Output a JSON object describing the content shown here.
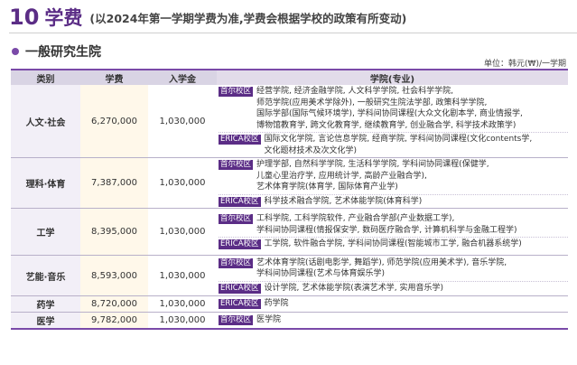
{
  "header": {
    "number": "10",
    "title": "学费",
    "subtitle": "(以2024年第一学期学费为准,学费会根据学校的政策有所变动)"
  },
  "section": {
    "title": "一般研究生院"
  },
  "unit": "单位：韩元(₩)/一学期",
  "table": {
    "headers": [
      "类别",
      "学费",
      "入学金",
      "学院(专业)"
    ],
    "rows": [
      {
        "category": "人文·社会",
        "tuition": "6,270,000",
        "admission": "1,030,000",
        "campuses": [
          {
            "tag": "首尔校区",
            "colleges": "经营学院, 经济金融学院, 人文科学学院, 社会科学学院,\n师范学院(应用美术学除外), 一般研究生院法学部, 政策科学学院,\n国际学部(国际气候环境学), 学科间协同课程(大众文化剧本学, 商业情报学,\n博物馆教育学, 跨文化教育学, 继续教育学, 创业融合学, 科学技术政策学)"
          },
          {
            "tag": "ERICA校区",
            "colleges": "国际文化学院, 言论信息学院, 经商学院, 学科间协同课程(文化contents学,\n文化题材技术及次文化学)"
          }
        ]
      },
      {
        "category": "理科·体育",
        "tuition": "7,387,000",
        "admission": "1,030,000",
        "campuses": [
          {
            "tag": "首尔校区",
            "colleges": "护理学部, 自然科学学院, 生活科学学院, 学科间协同课程(保健学,\n儿童心里治疗学, 应用统计学, 高龄产业融合学),\n艺术体育学院(体育学, 国际体育产业学)"
          },
          {
            "tag": "ERICA校区",
            "colleges": "科学技术融合学院, 艺术体能学院(体育科学)"
          }
        ]
      },
      {
        "category": "工学",
        "tuition": "8,395,000",
        "admission": "1,030,000",
        "campuses": [
          {
            "tag": "首尔校区",
            "colleges": "工科学院, 工科学院软件, 产业融合学部(产业数据工学),\n学科间协同课程(情报保安学, 数码医疗融合学, 计算机科学与金融工程学)"
          },
          {
            "tag": "ERICA校区",
            "colleges": "工学院, 软件融合学院, 学科间协同课程(智能城市工学, 融合机器系统学)"
          }
        ]
      },
      {
        "category": "艺能·音乐",
        "tuition": "8,593,000",
        "admission": "1,030,000",
        "campuses": [
          {
            "tag": "首尔校区",
            "colleges": "艺术体育学院(话剧电影学, 舞蹈学), 师范学院(应用美术学), 音乐学院,\n学科间协同课程(艺术与体育娱乐学)"
          },
          {
            "tag": "ERICA校区",
            "colleges": "设计学院, 艺术体能学院(表演艺术学, 实用音乐学)"
          }
        ]
      },
      {
        "category": "药学",
        "tuition": "8,720,000",
        "admission": "1,030,000",
        "campuses": [
          {
            "tag": "ERICA校区",
            "colleges": "药学院"
          }
        ]
      },
      {
        "category": "医学",
        "tuition": "9,782,000",
        "admission": "1,030,000",
        "campuses": [
          {
            "tag": "首尔校区",
            "colleges": "医学院"
          }
        ]
      }
    ]
  },
  "colors": {
    "accent": "#5b2d86",
    "header_bg": "#d9d4e4",
    "tuition_bg": "#fff8ea",
    "category_bg": "#f2eff7"
  }
}
